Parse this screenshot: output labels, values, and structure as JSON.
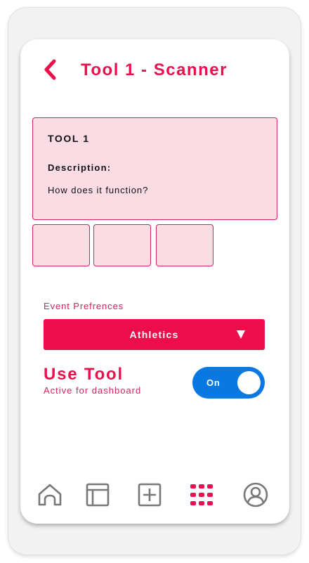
{
  "header": {
    "back_icon": "chevron-left-icon",
    "title": "Tool 1 - Scanner"
  },
  "card": {
    "title": "TOOL 1",
    "description_label": "Description:",
    "description_text": "How does it function?"
  },
  "thumbnails": {
    "count": 3
  },
  "preferences": {
    "label": "Event Prefrences",
    "selected": "Athletics",
    "arrow_icon": "triangle-down-icon"
  },
  "use_tool": {
    "title": "Use Tool",
    "subtitle": "Active for dashboard",
    "toggle_label": "On",
    "toggle_state": true
  },
  "nav": {
    "items": [
      {
        "icon": "home-icon",
        "active": false
      },
      {
        "icon": "layout-icon",
        "active": false
      },
      {
        "icon": "add-icon",
        "active": false
      },
      {
        "icon": "apps-grid-icon",
        "active": true
      },
      {
        "icon": "profile-icon",
        "active": false
      }
    ]
  },
  "colors": {
    "accent": "#e8104d",
    "card_fill": "#fbdbe4",
    "toggle_on": "#0a78e3",
    "nav_icon": "#777777"
  }
}
